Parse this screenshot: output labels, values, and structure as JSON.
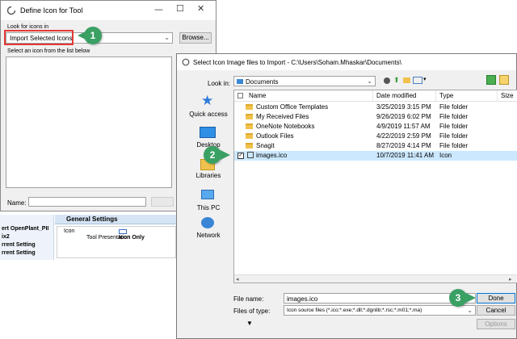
{
  "bg_dialog": {
    "title": "Define Icon for Tool",
    "look_for_label": "Look for icons in",
    "look_for_value": "Import Selected Icons",
    "browse_label": "Browse...",
    "select_label": "Select an icon from the list below",
    "name_label": "Name:"
  },
  "bg_panel": {
    "left_items": [
      "ert OpenPlant_PII",
      "ix2",
      "rrent Setting",
      "rrent Setting"
    ],
    "general_settings_header": "General Settings",
    "rows": [
      {
        "label": "Icon",
        "value": ""
      },
      {
        "label": "Tool Presentation",
        "value": "Icon Only"
      }
    ]
  },
  "main_dialog": {
    "title": "Select Icon Image files to Import - C:\\Users\\Soham.Mhaskar\\Documents\\",
    "look_in_label": "Look in:",
    "look_in_value": "Documents",
    "places": [
      {
        "label": "Quick access",
        "icon": "star-icon"
      },
      {
        "label": "Desktop",
        "icon": "desktop-icon"
      },
      {
        "label": "Libraries",
        "icon": "libraries-icon"
      },
      {
        "label": "This PC",
        "icon": "computer-icon"
      },
      {
        "label": "Network",
        "icon": "network-icon"
      }
    ],
    "columns": [
      "Name",
      "Date modified",
      "Type",
      "Size"
    ],
    "files": [
      {
        "name": "Custom Office Templates",
        "date": "3/25/2019 3:15 PM",
        "type": "File folder",
        "kind": "folder"
      },
      {
        "name": "My Received Files",
        "date": "9/26/2019 6:02 PM",
        "type": "File folder",
        "kind": "folder"
      },
      {
        "name": "OneNote Notebooks",
        "date": "4/9/2019 11:57 AM",
        "type": "File folder",
        "kind": "folder"
      },
      {
        "name": "Outlook Files",
        "date": "4/22/2019 2:59 PM",
        "type": "File folder",
        "kind": "folder"
      },
      {
        "name": "Snagit",
        "date": "8/27/2019 4:14 PM",
        "type": "File folder",
        "kind": "folder"
      },
      {
        "name": "images.ico",
        "date": "10/7/2019 11:41 AM",
        "type": "Icon",
        "kind": "file"
      }
    ],
    "file_name_label": "File name:",
    "file_name_value": "images.ico",
    "files_of_type_label": "Files of type:",
    "files_of_type_value": "Icon source files (*.ico;*.exe;*.dll;*.dgnlib;*.rsc;*.m01;*.ma)",
    "done_label": "Done",
    "cancel_label": "Cancel",
    "options_label": "Options"
  },
  "callouts": [
    "1",
    "2",
    "3"
  ],
  "colors": {
    "callout": "#3aa064",
    "highlight_box": "#e53935",
    "selected_row": "#cce8ff"
  }
}
